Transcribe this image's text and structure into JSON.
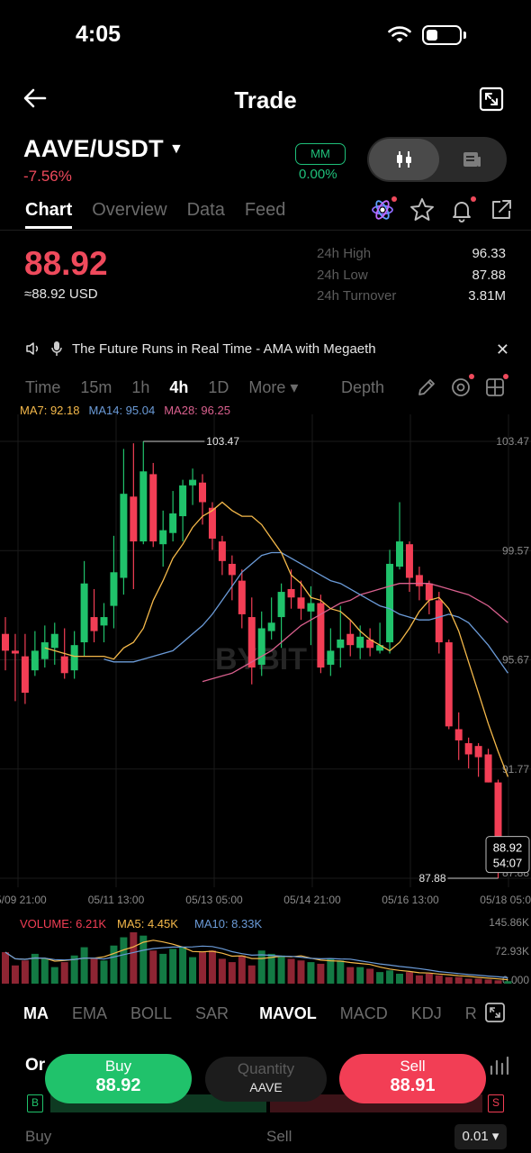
{
  "status": {
    "time": "4:05"
  },
  "nav": {
    "title": "Trade"
  },
  "pair": {
    "symbol": "AAVE/USDT",
    "change": "-7.56%",
    "mm_label": "MM",
    "mm_value": "0.00%"
  },
  "tabs": [
    {
      "label": "Chart",
      "active": true
    },
    {
      "label": "Overview",
      "active": false
    },
    {
      "label": "Data",
      "active": false
    },
    {
      "label": "Feed",
      "active": false
    }
  ],
  "ticker": {
    "price": "88.92",
    "usd": "≈88.92 USD",
    "stats": [
      {
        "label": "24h High",
        "value": "96.33"
      },
      {
        "label": "24h Low",
        "value": "87.88"
      },
      {
        "label": "24h Turnover",
        "value": "3.81M"
      }
    ]
  },
  "announcement": {
    "text": "The Future Runs in Real Time -  AMA with Megaeth"
  },
  "timeframes": [
    {
      "label": "Time",
      "active": false
    },
    {
      "label": "15m",
      "active": false
    },
    {
      "label": "1h",
      "active": false
    },
    {
      "label": "4h",
      "active": true
    },
    {
      "label": "1D",
      "active": false
    },
    {
      "label": "More ▾",
      "active": false
    }
  ],
  "depth_label": "Depth",
  "ma_legend": {
    "ma7": "MA7: 92.18",
    "ma14": "MA14: 95.04",
    "ma28": "MA28: 96.25"
  },
  "chart_data": {
    "type": "candlestick",
    "watermark": "BYBIT",
    "y_ticks": [
      "103.47",
      "99.57",
      "95.67",
      "91.77",
      "87.88"
    ],
    "x_ticks": [
      "05/09 21:00",
      "05/11 13:00",
      "05/13 05:00",
      "05/14 21:00",
      "05/16 13:00",
      "05/18 05:00"
    ],
    "high_marker": "103.47",
    "low_marker": "87.88",
    "last_price": "88.92",
    "countdown": "54:07",
    "ylim": [
      87.88,
      103.47
    ],
    "candles": [
      [
        96.6,
        96.0,
        97.2,
        95.3
      ],
      [
        96.0,
        95.9,
        96.6,
        94.2
      ],
      [
        95.8,
        94.5,
        96.6,
        94.1
      ],
      [
        95.3,
        96.0,
        96.7,
        95.1
      ],
      [
        95.7,
        96.3,
        96.9,
        95.4
      ],
      [
        96.1,
        96.6,
        97.0,
        95.5
      ],
      [
        95.8,
        95.2,
        96.8,
        95.0
      ],
      [
        95.3,
        96.2,
        96.7,
        95.0
      ],
      [
        96.3,
        98.4,
        99.2,
        95.8
      ],
      [
        97.2,
        96.7,
        98.2,
        96.3
      ],
      [
        96.9,
        97.2,
        97.7,
        96.3
      ],
      [
        97.6,
        98.8,
        100.1,
        96.8
      ],
      [
        98.6,
        101.6,
        103.2,
        98.0
      ],
      [
        101.5,
        99.9,
        103.4,
        98.2
      ],
      [
        99.9,
        102.4,
        103.47,
        99.8
      ],
      [
        102.3,
        99.9,
        102.7,
        99.7
      ],
      [
        99.8,
        100.3,
        101.0,
        99.0
      ],
      [
        100.2,
        100.9,
        101.7,
        99.9
      ],
      [
        100.8,
        101.9,
        102.1,
        99.9
      ],
      [
        101.9,
        102.1,
        102.5,
        101.2
      ],
      [
        102.0,
        101.3,
        102.3,
        100.5
      ],
      [
        101.1,
        100.0,
        101.3,
        99.6
      ],
      [
        99.9,
        99.2,
        100.1,
        98.7
      ],
      [
        99.1,
        98.7,
        99.4,
        97.8
      ],
      [
        98.5,
        97.3,
        98.9,
        96.8
      ],
      [
        97.2,
        95.4,
        97.9,
        94.8
      ],
      [
        95.5,
        96.8,
        97.4,
        95.1
      ],
      [
        96.7,
        97.0,
        97.9,
        96.4
      ],
      [
        97.2,
        98.1,
        98.4,
        96.1
      ],
      [
        98.2,
        97.9,
        98.9,
        97.5
      ],
      [
        97.9,
        97.5,
        98.5,
        97.1
      ],
      [
        97.4,
        97.7,
        98.3,
        96.2
      ],
      [
        97.7,
        95.4,
        98.0,
        95.2
      ],
      [
        95.5,
        96.0,
        96.8,
        95.1
      ],
      [
        96.1,
        96.4,
        97.6,
        95.4
      ],
      [
        96.6,
        96.2,
        97.1,
        95.8
      ],
      [
        96.1,
        96.5,
        96.9,
        95.7
      ],
      [
        96.4,
        96.1,
        96.8,
        95.8
      ],
      [
        96.0,
        96.2,
        97.0,
        95.9
      ],
      [
        96.3,
        99.1,
        99.6,
        95.9
      ],
      [
        99.0,
        99.9,
        101.3,
        98.9
      ],
      [
        99.8,
        98.6,
        99.9,
        98.1
      ],
      [
        98.7,
        98.3,
        99.0,
        97.8
      ],
      [
        98.4,
        97.8,
        98.5,
        97.3
      ],
      [
        97.8,
        96.3,
        98.1,
        95.9
      ],
      [
        96.3,
        93.3,
        96.4,
        93.2
      ],
      [
        93.2,
        92.8,
        93.8,
        92.1
      ],
      [
        92.7,
        92.3,
        92.9,
        91.8
      ],
      [
        92.6,
        92.2,
        92.7,
        91.5
      ],
      [
        92.3,
        91.3,
        92.5,
        91.3
      ],
      [
        91.3,
        88.7,
        91.4,
        87.88
      ],
      [
        88.9,
        88.92,
        89.2,
        88.4
      ]
    ],
    "ma7": [
      96.1,
      96.0,
      95.9,
      95.8,
      95.8,
      95.8,
      95.8,
      95.7,
      96.1,
      96.3,
      96.8,
      97.8,
      98.5,
      99.3,
      99.8,
      100.4,
      100.8,
      101.0,
      101.3,
      101.0,
      100.8,
      100.8,
      100.5,
      100.0,
      99.5,
      98.7,
      98.4,
      97.9,
      97.8,
      97.5,
      97.4,
      97.1,
      96.7,
      96.4,
      96.2,
      96.0,
      96.3,
      96.8,
      97.4,
      97.8,
      97.9,
      97.5,
      96.7,
      95.6,
      94.5,
      93.4,
      92.4,
      91.5
    ],
    "ma14": [
      95.7,
      95.6,
      95.6,
      95.6,
      95.7,
      95.8,
      95.9,
      96.0,
      96.3,
      96.6,
      96.9,
      97.3,
      97.8,
      98.3,
      98.8,
      99.1,
      99.4,
      99.5,
      99.5,
      99.3,
      99.1,
      98.9,
      98.7,
      98.5,
      98.4,
      98.2,
      98.0,
      97.8,
      97.6,
      97.5,
      97.3,
      97.2,
      97.1,
      97.1,
      97.2,
      97.3,
      97.2,
      97.0,
      96.6,
      96.2,
      95.7,
      95.2
    ],
    "ma28": [
      94.9,
      95.0,
      95.1,
      95.2,
      95.4,
      95.6,
      95.8,
      96.0,
      96.3,
      96.6,
      96.9,
      97.1,
      97.3,
      97.5,
      97.7,
      97.8,
      98.0,
      98.1,
      98.2,
      98.3,
      98.4,
      98.4,
      98.4,
      98.4,
      98.3,
      98.2,
      98.1,
      98.0,
      97.8,
      97.6,
      97.3,
      97.0
    ],
    "volume_legend": {
      "volume": "VOLUME: 6.21K",
      "ma5": "MA5: 4.45K",
      "ma10": "MA10: 8.33K"
    },
    "volume_ticks": [
      "145.86K",
      "72.93K",
      "0.000"
    ],
    "volume": [
      38,
      22,
      28,
      36,
      30,
      20,
      26,
      34,
      44,
      30,
      28,
      46,
      56,
      62,
      58,
      40,
      36,
      42,
      44,
      32,
      38,
      40,
      30,
      26,
      34,
      22,
      40,
      36,
      34,
      30,
      28,
      26,
      24,
      30,
      28,
      20,
      20,
      18,
      14,
      16,
      12,
      14,
      10,
      12,
      10,
      8,
      8,
      6,
      6,
      5,
      4,
      3
    ]
  },
  "indicators": [
    {
      "label": "MA",
      "active": true
    },
    {
      "label": "EMA",
      "active": false
    },
    {
      "label": "BOLL",
      "active": false
    },
    {
      "label": "SAR",
      "active": false
    },
    {
      "label": "MAVOL",
      "active": true
    },
    {
      "label": "MACD",
      "active": false
    },
    {
      "label": "KDJ",
      "active": false
    },
    {
      "label": "R",
      "active": false
    }
  ],
  "order": {
    "or_label": "Or",
    "buy_label": "Buy",
    "buy_price": "88.92",
    "qty_label": "Quantity",
    "qty_unit": "AAVE",
    "sell_label": "Sell",
    "sell_price": "88.91",
    "b_badge": "B",
    "s_badge": "S",
    "foot_buy": "Buy",
    "foot_sell": "Sell",
    "step": "0.01 ▾"
  },
  "colors": {
    "up": "#20c26b",
    "down": "#f23e55",
    "ma7": "#f5b94a",
    "ma14": "#6b9bd8",
    "ma28": "#d9608e"
  }
}
